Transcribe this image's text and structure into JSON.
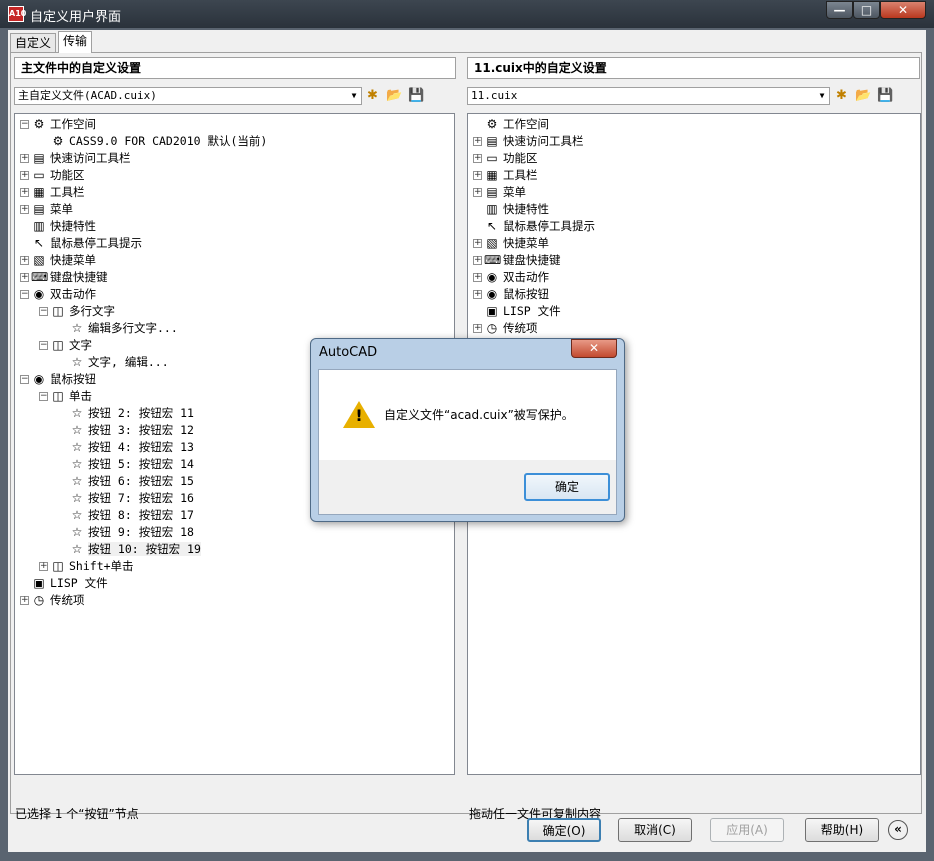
{
  "window": {
    "title": "自定义用户界面",
    "app_icon_text": "A10",
    "min_glyph": "—",
    "max_glyph": "□",
    "close_glyph": "✕"
  },
  "tabs": [
    {
      "label": "自定义"
    },
    {
      "label": "传输"
    }
  ],
  "left_panel": {
    "header": "主文件中的自定义设置",
    "combo_value": "主自定义文件(ACAD.cuix)",
    "status": "已选择 1 个“按钮”节点",
    "tree": [
      {
        "label": "工作空间",
        "expander": "−",
        "icon": "⚙"
      },
      {
        "label": "CASS9.0 FOR CAD2010 默认(当前)",
        "expander": "",
        "icon": "⚙"
      },
      {
        "label": "快速访问工具栏",
        "expander": "+",
        "icon": "▤"
      },
      {
        "label": "功能区",
        "expander": "+",
        "icon": "▭"
      },
      {
        "label": "工具栏",
        "expander": "+",
        "icon": "▦"
      },
      {
        "label": "菜单",
        "expander": "+",
        "icon": "▤"
      },
      {
        "label": "快捷特性",
        "expander": "",
        "icon": "▥"
      },
      {
        "label": "鼠标悬停工具提示",
        "expander": "",
        "icon": "↖"
      },
      {
        "label": "快捷菜单",
        "expander": "+",
        "icon": "▧"
      },
      {
        "label": "键盘快捷键",
        "expander": "+",
        "icon": "⌨"
      },
      {
        "label": "双击动作",
        "expander": "−",
        "icon": "◉"
      },
      {
        "label": "多行文字",
        "expander": "−",
        "icon": "◫"
      },
      {
        "label": "编辑多行文字...",
        "expander": "",
        "icon": "☆"
      },
      {
        "label": "文字",
        "expander": "−",
        "icon": "◫"
      },
      {
        "label": "文字, 编辑...",
        "expander": "",
        "icon": "☆"
      },
      {
        "label": "鼠标按钮",
        "expander": "−",
        "icon": "◉"
      },
      {
        "label": "单击",
        "expander": "−",
        "icon": "◫"
      },
      {
        "label": "按钮 2: 按钮宏 11",
        "expander": "",
        "icon": "☆"
      },
      {
        "label": "按钮 3: 按钮宏 12",
        "expander": "",
        "icon": "☆"
      },
      {
        "label": "按钮 4: 按钮宏 13",
        "expander": "",
        "icon": "☆"
      },
      {
        "label": "按钮 5: 按钮宏 14",
        "expander": "",
        "icon": "☆"
      },
      {
        "label": "按钮 6: 按钮宏 15",
        "expander": "",
        "icon": "☆"
      },
      {
        "label": "按钮 7: 按钮宏 16",
        "expander": "",
        "icon": "☆"
      },
      {
        "label": "按钮 8: 按钮宏 17",
        "expander": "",
        "icon": "☆"
      },
      {
        "label": "按钮 9: 按钮宏 18",
        "expander": "",
        "icon": "☆"
      },
      {
        "label": "按钮 10: 按钮宏 19",
        "expander": "",
        "icon": "☆",
        "selected": true
      },
      {
        "label": "Shift+单击",
        "expander": "+",
        "icon": "◫"
      },
      {
        "label": "LISP 文件",
        "expander": "",
        "icon": "▣"
      },
      {
        "label": "传统项",
        "expander": "+",
        "icon": "◷"
      }
    ]
  },
  "right_panel": {
    "header": "11.cuix中的自定义设置",
    "combo_value": "11.cuix",
    "status": "拖动任一文件可复制内容",
    "tree": [
      {
        "label": "工作空间",
        "expander": "",
        "icon": "⚙"
      },
      {
        "label": "快速访问工具栏",
        "expander": "+",
        "icon": "▤"
      },
      {
        "label": "功能区",
        "expander": "+",
        "icon": "▭"
      },
      {
        "label": "工具栏",
        "expander": "+",
        "icon": "▦"
      },
      {
        "label": "菜单",
        "expander": "+",
        "icon": "▤"
      },
      {
        "label": "快捷特性",
        "expander": "",
        "icon": "▥"
      },
      {
        "label": "鼠标悬停工具提示",
        "expander": "",
        "icon": "↖"
      },
      {
        "label": "快捷菜单",
        "expander": "+",
        "icon": "▧"
      },
      {
        "label": "键盘快捷键",
        "expander": "+",
        "icon": "⌨"
      },
      {
        "label": "双击动作",
        "expander": "+",
        "icon": "◉"
      },
      {
        "label": "鼠标按钮",
        "expander": "+",
        "icon": "◉"
      },
      {
        "label": "LISP 文件",
        "expander": "",
        "icon": "▣"
      },
      {
        "label": "传统项",
        "expander": "+",
        "icon": "◷"
      }
    ]
  },
  "toolbar_icons": {
    "new": "✱",
    "open": "📂",
    "save": "💾"
  },
  "buttons": {
    "ok": "确定(O)",
    "cancel": "取消(C)",
    "apply": "应用(A)",
    "help": "帮助(H)",
    "collapse": "«"
  },
  "dialog": {
    "title": "AutoCAD",
    "message": "自定义文件“acad.cuix”被写保护。",
    "ok": "确定",
    "warn_glyph": "!",
    "close_glyph": "✕"
  }
}
